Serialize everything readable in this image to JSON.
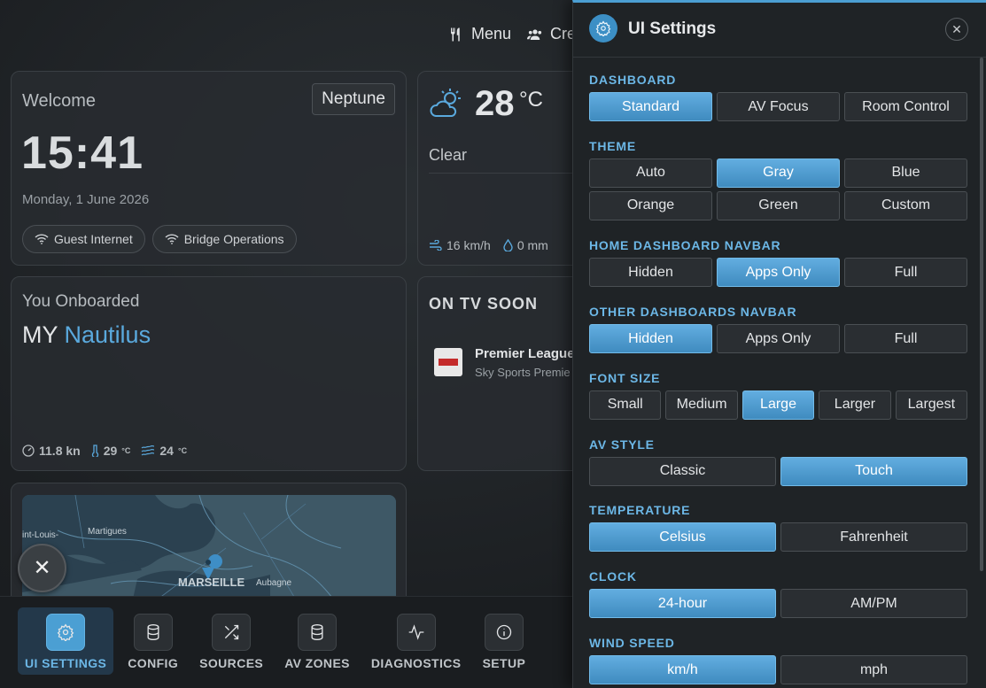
{
  "colors": {
    "accent": "#4b9fd3",
    "accent_text": "#6cb7e6",
    "panel_bg": "#1f2326"
  },
  "topnav": {
    "menu": "Menu",
    "crew": "Cre"
  },
  "welcome": {
    "label": "Welcome",
    "vessel_button": "Neptune",
    "time": "15:41",
    "date": "Monday, 1 June 2026",
    "networks": [
      "Guest Internet",
      "Bridge Operations"
    ]
  },
  "weather": {
    "temperature": "28",
    "unit": "°C",
    "condition": "Clear",
    "wind": "16 km/h",
    "rain": "0 mm"
  },
  "onboard": {
    "label": "You Onboarded",
    "prefix": "MY",
    "vessel": "Nautilus",
    "speed": "11.8 kn",
    "air_temp": "29",
    "water_temp": "24",
    "temp_unit": "°C"
  },
  "tv": {
    "title": "ON TV SOON",
    "program": "Premier League",
    "channel": "Sky Sports Premie"
  },
  "map": {
    "labels": [
      "int-Louis-",
      "Martigues",
      "MARSEILLE",
      "Aubagne"
    ]
  },
  "bottom_tabs": [
    {
      "label": "UI SETTINGS",
      "icon": "gear-icon"
    },
    {
      "label": "CONFIG",
      "icon": "database-icon"
    },
    {
      "label": "SOURCES",
      "icon": "shuffle-icon"
    },
    {
      "label": "AV ZONES",
      "icon": "database-icon"
    },
    {
      "label": "DIAGNOSTICS",
      "icon": "activity-icon"
    },
    {
      "label": "SETUP",
      "icon": "info-icon"
    }
  ],
  "panel": {
    "title": "UI Settings",
    "sections": {
      "dashboard": {
        "title": "DASHBOARD",
        "options": [
          "Standard",
          "AV Focus",
          "Room Control"
        ],
        "selected": "Standard"
      },
      "theme": {
        "title": "THEME",
        "options": [
          "Auto",
          "Gray",
          "Blue",
          "Orange",
          "Green",
          "Custom"
        ],
        "selected": "Gray"
      },
      "home_navbar": {
        "title": "HOME DASHBOARD NAVBAR",
        "options": [
          "Hidden",
          "Apps Only",
          "Full"
        ],
        "selected": "Apps Only"
      },
      "other_navbar": {
        "title": "OTHER DASHBOARDS NAVBAR",
        "options": [
          "Hidden",
          "Apps Only",
          "Full"
        ],
        "selected": "Hidden"
      },
      "font_size": {
        "title": "FONT SIZE",
        "options": [
          "Small",
          "Medium",
          "Large",
          "Larger",
          "Largest"
        ],
        "selected": "Large"
      },
      "av_style": {
        "title": "AV STYLE",
        "options": [
          "Classic",
          "Touch"
        ],
        "selected": "Touch"
      },
      "temperature": {
        "title": "TEMPERATURE",
        "options": [
          "Celsius",
          "Fahrenheit"
        ],
        "selected": "Celsius"
      },
      "clock": {
        "title": "CLOCK",
        "options": [
          "24-hour",
          "AM/PM"
        ],
        "selected": "24-hour"
      },
      "wind_speed": {
        "title": "WIND SPEED",
        "options": [
          "km/h",
          "mph"
        ],
        "selected": "km/h"
      }
    }
  }
}
